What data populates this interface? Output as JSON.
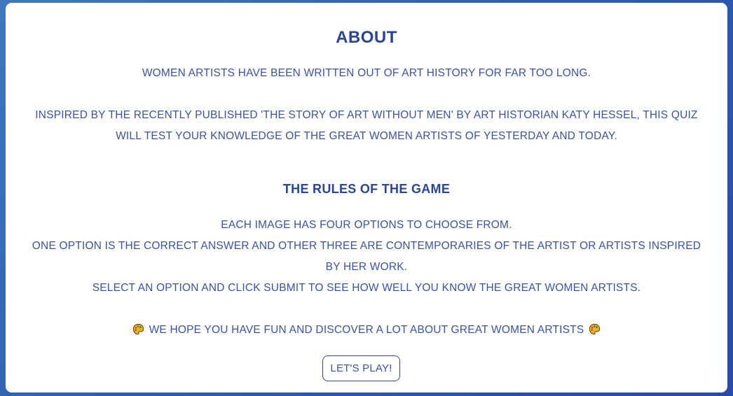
{
  "about": {
    "title": "ABOUT",
    "intro": "WOMEN ARTISTS HAVE BEEN WRITTEN OUT OF ART HISTORY FOR FAR TOO LONG.",
    "inspired_line1": "INSPIRED BY THE RECENTLY PUBLISHED 'THE STORY OF ART WITHOUT MEN' BY ART HISTORIAN KATY HESSEL, THIS QUIZ",
    "inspired_line2": "WILL TEST YOUR KNOWLEDGE OF THE GREAT WOMEN ARTISTS OF YESTERDAY AND TODAY."
  },
  "rules": {
    "title": "THE RULES OF THE GAME",
    "line1": "EACH IMAGE HAS FOUR OPTIONS TO CHOOSE FROM.",
    "line2a": "ONE OPTION IS THE CORRECT ANSWER AND OTHER THREE ARE CONTEMPORARIES OF THE ARTIST OR ARTISTS INSPIRED",
    "line2b": "BY HER WORK.",
    "line3": "SELECT AN OPTION AND CLICK SUBMIT TO SEE HOW WELL YOU KNOW THE GREAT WOMEN ARTISTS."
  },
  "closing": {
    "text": "WE HOPE YOU HAVE FUN AND DISCOVER A LOT ABOUT GREAT WOMEN ARTISTS",
    "icon": "artist-palette-icon"
  },
  "play_button": {
    "label": "LET'S PLAY!"
  },
  "colors": {
    "accent": "#2e4a9e",
    "background_gradient_start": "#3f78bf",
    "background_gradient_end": "#2a4aa3",
    "palette_emoji": "#f4b400"
  }
}
